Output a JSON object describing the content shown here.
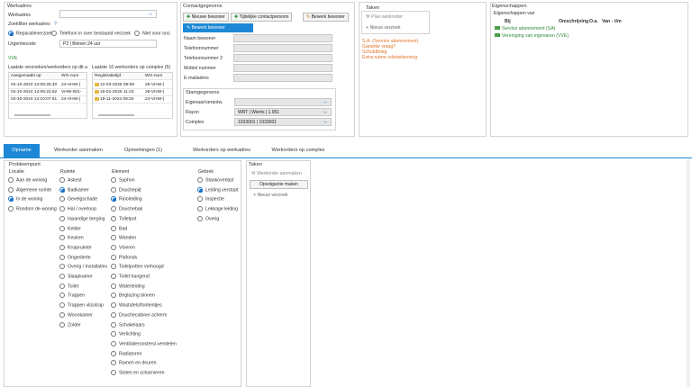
{
  "werkadres": {
    "title": "Werkadres",
    "werkadres_label": "Werkadres",
    "zoekfilter_label": "Zoekfilter werkadres",
    "help": "?",
    "filters": [
      "Reparatieverzoek",
      "Telefoon in over bestaand verzoek",
      "Niet voor ons"
    ],
    "urgentie_label": "Urgentiecode",
    "urgentie_value": "P2 | Binnen 24 uur",
    "vve": "VVE",
    "laatste_verzoeken_title": "Laatste verzoeken/werkorders op dit ad",
    "verzoeken_cols": [
      "Aangemaakt op",
      "WO-num"
    ],
    "verzoeken_rows": [
      [
        "04-10-2024 14:09:26.40",
        "24-VHW-("
      ],
      [
        "04-10-2024 14:06:22.62",
        "VHW-001-"
      ],
      [
        "04-10-2024 14:10:07.51",
        "24-VHW-("
      ]
    ],
    "laatste_werkorders_title": "Laatste 10 werkorders op complex (5)",
    "werkorders_cols": [
      "Registratietijd",
      "WO-num"
    ],
    "werkorders_rows": [
      [
        "12-03-2025 09:59",
        "25-VHW-("
      ],
      [
        "16-01-2025 11:43",
        "25-VHW-("
      ],
      [
        "19-11-2024 09:32",
        "24-VHW-("
      ]
    ]
  },
  "contact": {
    "title": "Contactgegevens",
    "btn_nieuwe": "Nieuwe bewoner",
    "btn_tijdelijk": "Tijdelijke contactpersoon",
    "btn_bewerk": "Bewerk bewoner",
    "btn_bewerk2": "Bewerk bewoner",
    "fields": [
      "Naam bewoner",
      "Telefoonnummer",
      "Telefoonnummer 2",
      "Mobiel nummer",
      "E-mailadres"
    ]
  },
  "stam": {
    "title": "Stamgegevens",
    "fields": [
      {
        "label": "Eigenaar/verantw.",
        "value": ""
      },
      {
        "label": "Rayon",
        "value": "WRT | Wierts | 1.951"
      },
      {
        "label": "Complex",
        "value": "1033001 | 1033001"
      }
    ]
  },
  "taken_top": {
    "title": "Taken",
    "plan": "Plan werkorder",
    "nieuw": "Nieuw verzoek",
    "links": [
      "S.A. (Service abonnement)",
      "Garantie vraag?",
      "Schuldbrieg",
      "Extra ruime rolstoelwoning"
    ]
  },
  "eigenschappen": {
    "title": "Eigenschappen",
    "sub": "Eigenschappen van",
    "cols": [
      "Bij",
      "Omschrijving",
      "O.a.",
      "Van - t/m"
    ],
    "rows": [
      "Service abonnement (SA)",
      "Vereniging van eigenaren (VVE)"
    ]
  },
  "tabs": [
    "Opname",
    "Werkorder aanmaken",
    "Opmerkingen (1)",
    "Werkorders op werkadres",
    "Werkorders op complex"
  ],
  "probleem": {
    "title": "Probleempunt",
    "locatie_header": "Locatie",
    "locatie": [
      "Aan de woning",
      "Algemene ruimte",
      "In de woning",
      "Rondom de woning"
    ],
    "locatie_selected": 2,
    "ruimte_header": "Ruimte",
    "ruimte": [
      "Askest",
      "Badkamer",
      "Gevelgschade",
      "Hal / overloop",
      "Inpandige berging",
      "Kelder",
      "Keuken",
      "Kruipruimte",
      "Ongedierte",
      "Overig / Installaties",
      "Slaapkamer",
      "Toilet",
      "Trappen",
      "Trappen vlizotrap",
      "Woonkamer",
      "Zolder"
    ],
    "ruimte_selected": 1,
    "element_header": "Element",
    "element": [
      "Syphon",
      "Douchepijt",
      "Riooleiding",
      "Douchebak",
      "Toiletpot",
      "Bad",
      "Wanden",
      "Vloeren",
      "Plafonds",
      "Toiletpotten verhoogd",
      "Toilet hangend",
      "Waterleiding",
      "Beglazing binnen",
      "Wastafels/fonteintjes",
      "Douchecabine/-scherm",
      "Schakelaars",
      "Verlichting",
      "Ventilatieroosters/-ventielen",
      "Radiatoren",
      "Ramen en deuren",
      "Sloten en scharnieren"
    ],
    "element_selected": 2,
    "gebrek_header": "Gebrek",
    "gebrek": [
      "Stankoverlast",
      "Leiding verstopt",
      "Inspectie",
      "Lekkage leiding",
      "Overig"
    ],
    "gebrek_selected": 1
  },
  "taken_bottom": {
    "title": "Taken",
    "werkorder": "Werkorder aanmaken",
    "opvolg": "Opvolgactie maken",
    "nieuw": "Nieuw verzoek"
  },
  "colors": {
    "accent": "#1e88d6",
    "orange": "#e0722a",
    "green": "#2e8b3a"
  }
}
